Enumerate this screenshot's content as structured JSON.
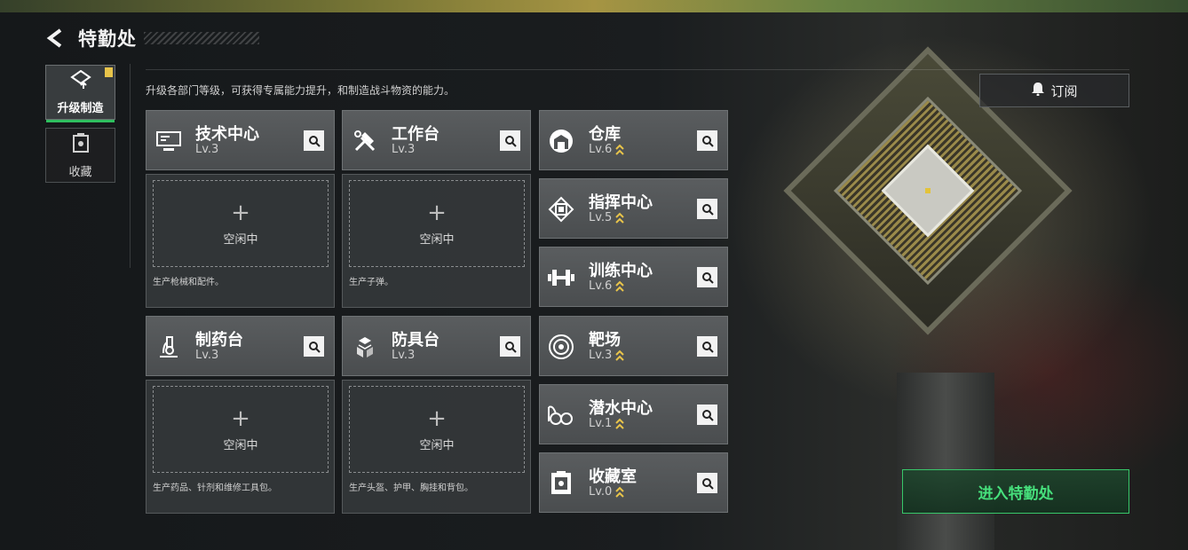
{
  "header": {
    "title": "特勤处"
  },
  "tabs": [
    {
      "label": "升级制造",
      "icon": "upgrade-icon",
      "active": true,
      "has_badge": true
    },
    {
      "label": "收藏",
      "icon": "collection-icon",
      "active": false,
      "has_badge": false
    }
  ],
  "description": "升级各部门等级，可获得专属能力提升，和制造战斗物资的能力。",
  "subscribe": {
    "label": "订阅",
    "icon": "bell-icon"
  },
  "production_cards": [
    {
      "name": "技术中心",
      "level": "Lv.3",
      "icon": "monitor-icon",
      "slot_status": "空闲中",
      "desc": "生产枪械和配件。"
    },
    {
      "name": "工作台",
      "level": "Lv.3",
      "icon": "tools-icon",
      "slot_status": "空闲中",
      "desc": "生产子弹。"
    },
    {
      "name": "制药台",
      "level": "Lv.3",
      "icon": "microscope-icon",
      "slot_status": "空闲中",
      "desc": "生产药品、针剂和维修工具包。"
    },
    {
      "name": "防具台",
      "level": "Lv.3",
      "icon": "armor-icon",
      "slot_status": "空闲中",
      "desc": "生产头盔、护甲、胸挂和背包。"
    }
  ],
  "facilities": [
    {
      "name": "仓库",
      "level": "Lv.6",
      "icon": "warehouse-icon",
      "upgradable": true
    },
    {
      "name": "指挥中心",
      "level": "Lv.5",
      "icon": "chip-icon",
      "upgradable": true
    },
    {
      "name": "训练中心",
      "level": "Lv.6",
      "icon": "dumbbell-icon",
      "upgradable": true
    },
    {
      "name": "靶场",
      "level": "Lv.3",
      "icon": "target-icon",
      "upgradable": true
    },
    {
      "name": "潜水中心",
      "level": "Lv.1",
      "icon": "diving-icon",
      "upgradable": true
    },
    {
      "name": "收藏室",
      "level": "Lv.0",
      "icon": "vault-icon",
      "upgradable": true
    }
  ],
  "enter_button": {
    "label": "进入特勤处"
  },
  "colors": {
    "accent": "#2fbf5f",
    "upgrade": "#e8c44a",
    "panel": "#4f5254"
  }
}
